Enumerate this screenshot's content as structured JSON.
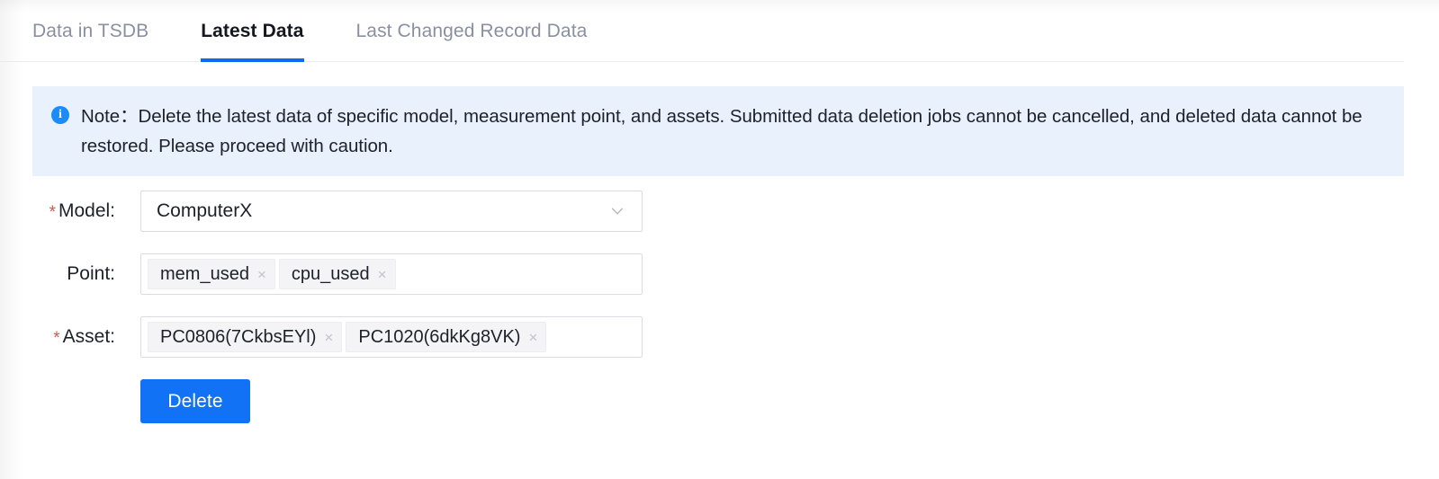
{
  "tabs": [
    {
      "label": "Data in TSDB",
      "active": false
    },
    {
      "label": "Latest Data",
      "active": true
    },
    {
      "label": "Last Changed Record Data",
      "active": false
    }
  ],
  "note": {
    "icon": "info-circle-icon",
    "text": "Note：Delete the latest data of specific model, measurement point, and assets. Submitted data deletion jobs cannot be cancelled, and deleted data cannot be restored. Please proceed with caution."
  },
  "form": {
    "model": {
      "label": "Model:",
      "required": true,
      "required_marker": "*",
      "value": "ComputerX",
      "dropdown_icon": "chevron-down-icon"
    },
    "point": {
      "label": "Point:",
      "required": false,
      "required_marker": "",
      "tags": [
        {
          "label": "mem_used",
          "close": "×"
        },
        {
          "label": "cpu_used",
          "close": "×"
        }
      ]
    },
    "asset": {
      "label": "Asset:",
      "required": true,
      "required_marker": "*",
      "tags": [
        {
          "label": "PC0806(7CkbsEYl)",
          "close": "×"
        },
        {
          "label": "PC1020(6dkKg8VK)",
          "close": "×"
        }
      ]
    },
    "submit": {
      "label": "Delete"
    }
  },
  "colors": {
    "accent": "#1272f5",
    "tab_underline": "#0b6cf3",
    "note_background": "#e9f1fd",
    "info_icon": "#1a8bfb",
    "required_star": "#f04a4a",
    "inactive_tab_text": "#8a90a2"
  }
}
